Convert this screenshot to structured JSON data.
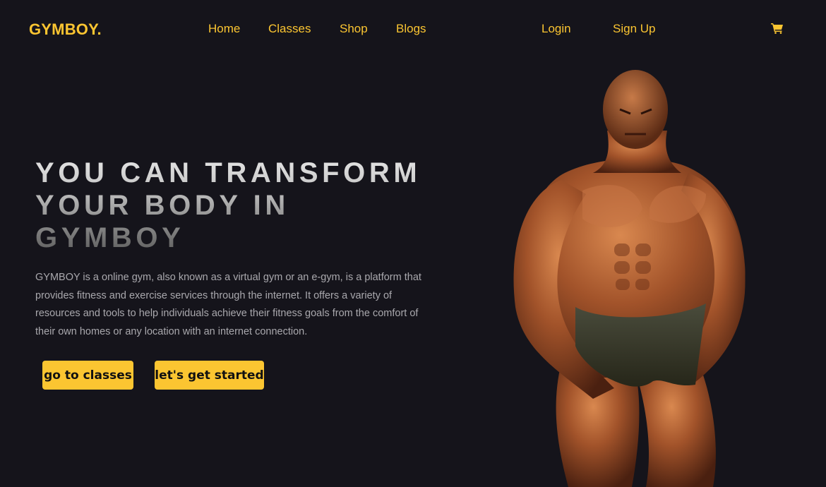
{
  "nav": {
    "logo": "GYMBOY.",
    "links": [
      "Home",
      "Classes",
      "Shop",
      "Blogs"
    ],
    "login": "Login",
    "signup": "Sign Up",
    "cart_icon": "cart-icon"
  },
  "hero": {
    "headline_lines": [
      "YOU CAN TRANSFORM",
      "YOUR BODY IN",
      "GYMBOY"
    ],
    "description": "GYMBOY is a online gym, also known as a virtual gym or an e-gym, is a platform that provides fitness and exercise services through the internet. It offers a variety of resources and tools to help individuals achieve their fitness goals from the comfort of their own homes or any location with an internet connection.",
    "buttons": {
      "classes": "go to classes",
      "start": "let's get started"
    },
    "image": "bodybuilder-photo"
  },
  "colors": {
    "background": "#15141b",
    "accent": "#fbc531",
    "text_muted": "#a9a8ad"
  }
}
